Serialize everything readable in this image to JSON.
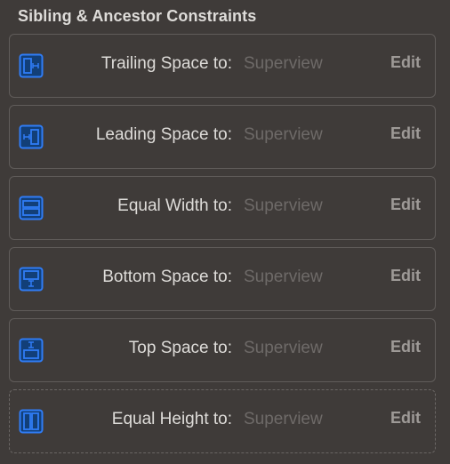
{
  "section": {
    "title": "Sibling & Ancestor Constraints"
  },
  "accent_color": "#2f7cf6",
  "constraints": [
    {
      "icon": "trailing-space-icon",
      "label": "Trailing Space to:",
      "target": "Superview",
      "edit_label": "Edit"
    },
    {
      "icon": "leading-space-icon",
      "label": "Leading Space to:",
      "target": "Superview",
      "edit_label": "Edit"
    },
    {
      "icon": "equal-width-icon",
      "label": "Equal Width to:",
      "target": "Superview",
      "edit_label": "Edit"
    },
    {
      "icon": "bottom-space-icon",
      "label": "Bottom Space to:",
      "target": "Superview",
      "edit_label": "Edit"
    },
    {
      "icon": "top-space-icon",
      "label": "Top Space to:",
      "target": "Superview",
      "edit_label": "Edit"
    },
    {
      "icon": "equal-height-icon",
      "label": "Equal Height to:",
      "target": "Superview",
      "edit_label": "Edit"
    }
  ]
}
